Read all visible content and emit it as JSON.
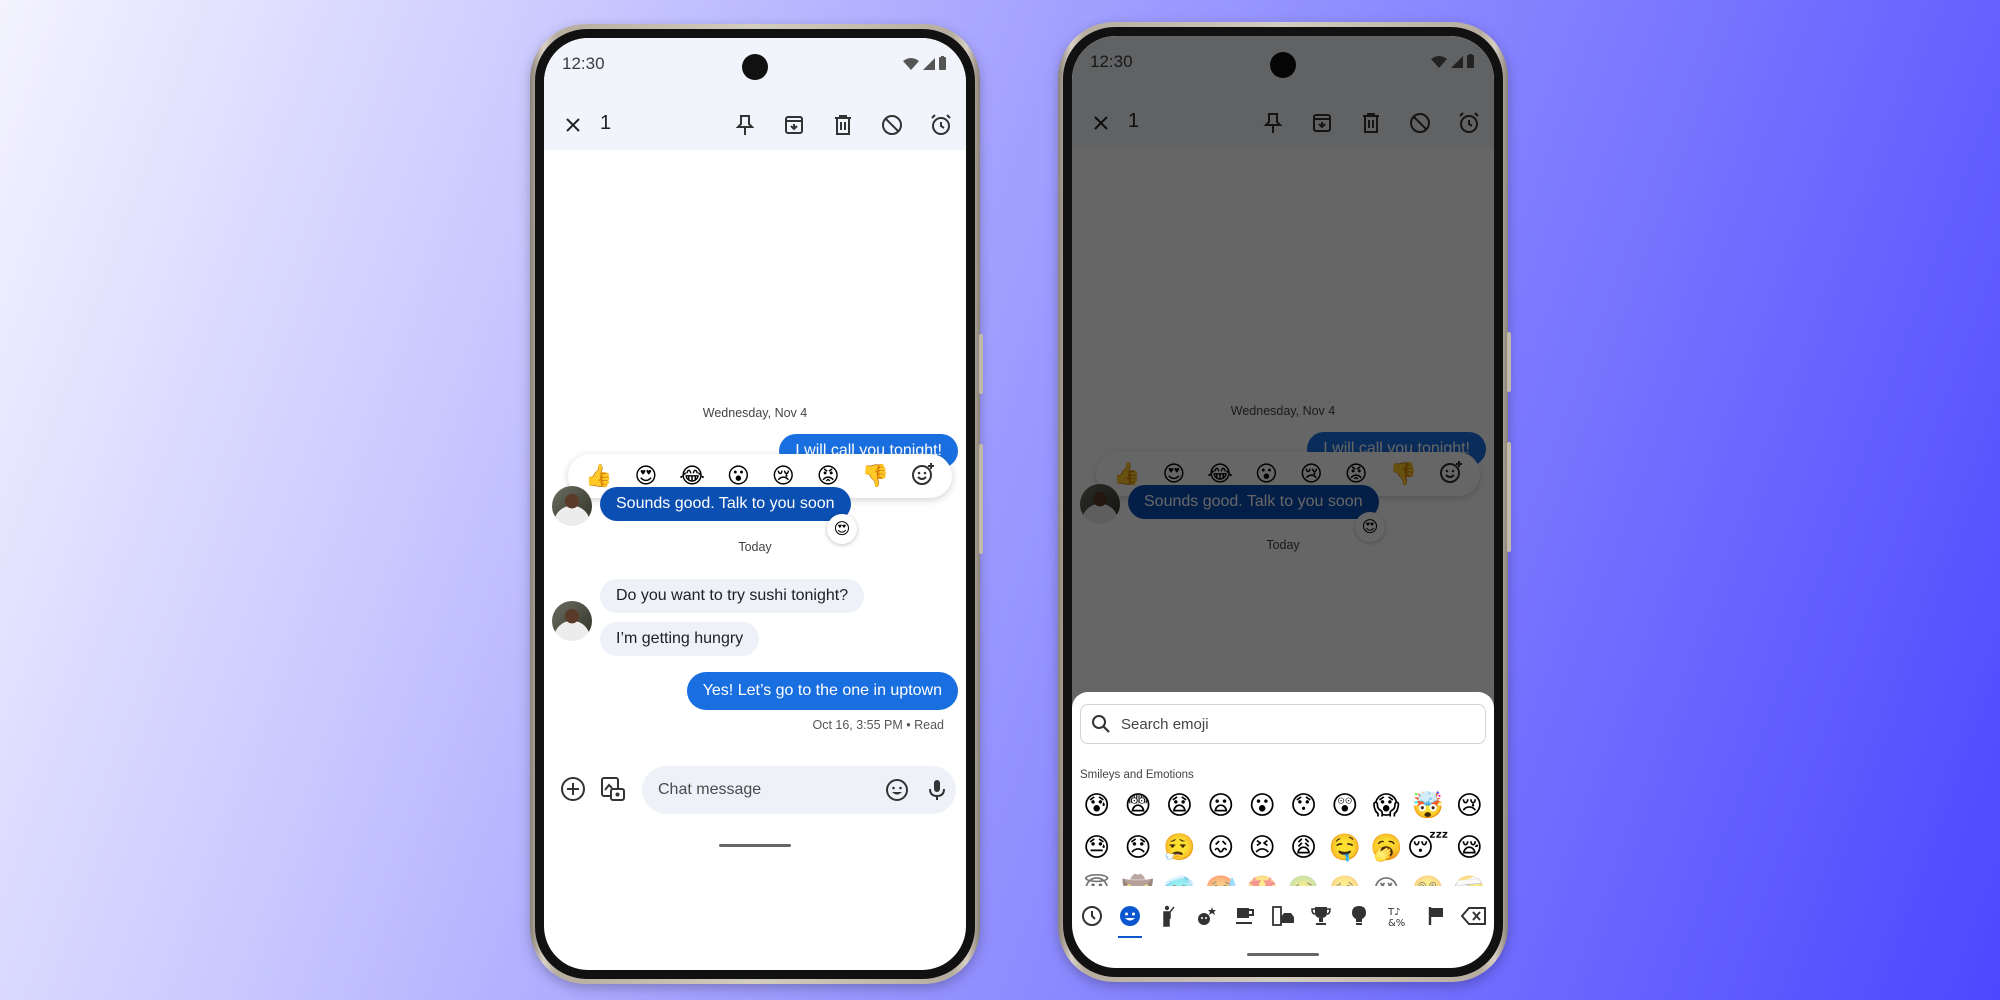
{
  "left_phone": {
    "status": {
      "time": "12:30"
    },
    "toolbar": {
      "selected_count": "1",
      "actions": [
        "pin",
        "archive",
        "delete",
        "block",
        "snooze"
      ]
    },
    "conversation": {
      "date_separator_1": "Wednesday, Nov 4",
      "partial_outgoing": "I will call you tonight!",
      "reaction_picker": [
        "👍",
        "😍",
        "😂",
        "😮",
        "😢",
        "😡",
        "👎"
      ],
      "selected_message": "Sounds good. Talk to you soon",
      "selected_message_reaction": "😍",
      "date_separator_2": "Today",
      "incoming_1": "Do you want to try sushi tonight?",
      "incoming_2": "I’m getting hungry",
      "outgoing_1": "Yes! Let’s go to the one in uptown",
      "outgoing_meta": "Oct 16, 3:55 PM • Read"
    },
    "composer": {
      "placeholder": "Chat message"
    }
  },
  "right_phone": {
    "status": {
      "time": "12:30"
    },
    "toolbar": {
      "selected_count": "1"
    },
    "conversation": {
      "date_separator_1": "Wednesday, Nov 4",
      "partial_outgoing": "I will call you tonight!",
      "reaction_picker": [
        "👍",
        "😍",
        "😂",
        "😮",
        "😢",
        "😡",
        "👎"
      ],
      "selected_message": "Sounds good. Talk to you soon",
      "selected_message_reaction": "😍",
      "date_separator_2": "Today"
    },
    "emoji_picker": {
      "search_placeholder": "Search emoji",
      "category_title": "Smileys and Emotions",
      "rows": [
        [
          "😰",
          "😨",
          "😧",
          "😦",
          "😮",
          "😯",
          "😲",
          "😱",
          "🤯",
          "😢"
        ],
        [
          "😓",
          "😞",
          "😮‍💨",
          "😖",
          "😣",
          "😩",
          "🤤",
          "🥱",
          "😴",
          "😪"
        ],
        [
          "😇",
          "🤠",
          "🥶",
          "🥵",
          "🤩",
          "🤢",
          "🥴",
          "😵",
          "😵‍💫",
          "🤕"
        ]
      ],
      "categories": [
        "recent",
        "smileys",
        "people",
        "animals",
        "food",
        "travel",
        "activities",
        "objects",
        "symbols",
        "flags",
        "backspace"
      ],
      "active_category": "smileys"
    }
  },
  "colors": {
    "outgoing_bubble": "#1a6fe0",
    "selected_bubble": "#0b4fb2",
    "incoming_bubble": "#eef1f7",
    "app_bar": "#f1f4fb",
    "accent": "#0b57d0"
  }
}
